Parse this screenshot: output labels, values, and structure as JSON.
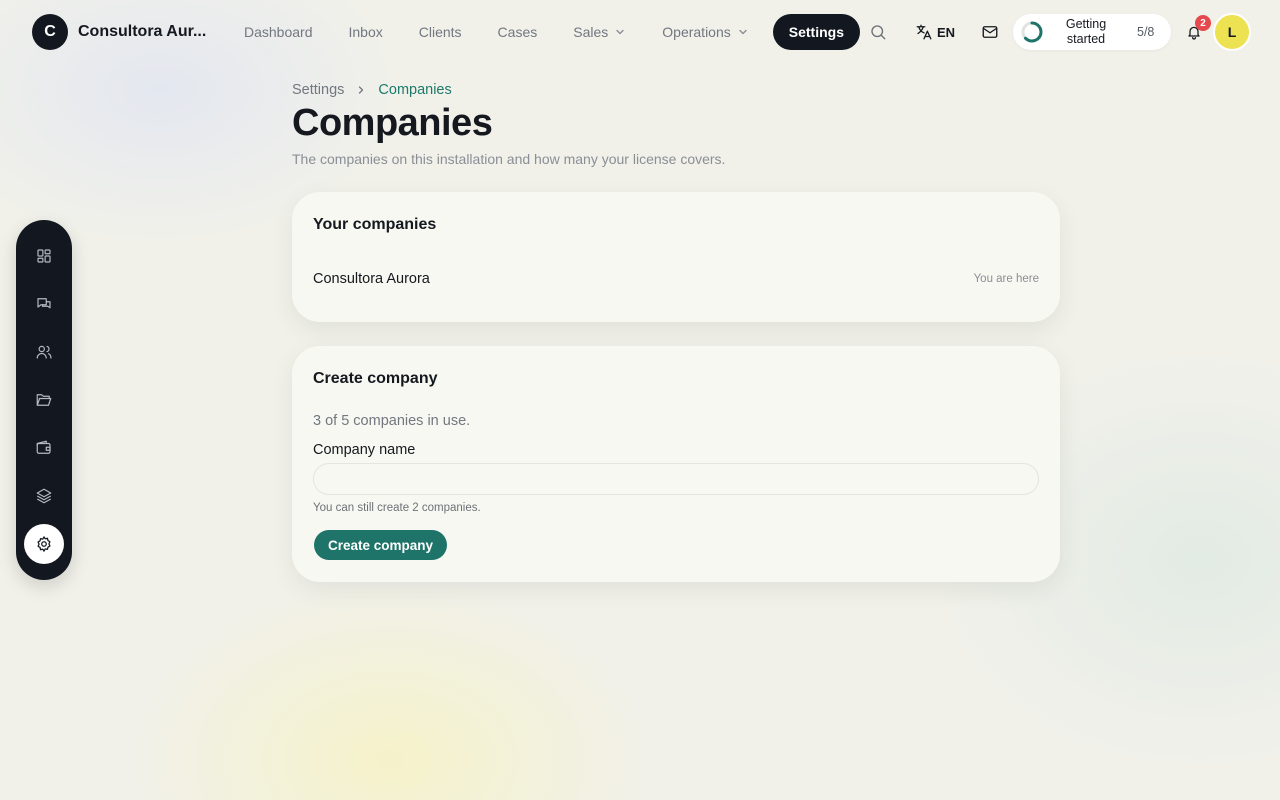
{
  "brand": {
    "logo_letter": "C",
    "name": "Consultora Aur..."
  },
  "nav": {
    "items": [
      {
        "label": "Dashboard"
      },
      {
        "label": "Inbox"
      },
      {
        "label": "Clients"
      },
      {
        "label": "Cases"
      },
      {
        "label": "Sales"
      },
      {
        "label": "Operations"
      },
      {
        "label": "Settings",
        "active": true
      }
    ]
  },
  "toolbar": {
    "search_icon": "search-icon",
    "language": "EN",
    "mail_icon": "mail-icon",
    "getting_started": {
      "label": "Getting started",
      "count": "5/8",
      "progress": 0.625
    },
    "notifications": {
      "count": "2"
    },
    "avatar_initial": "L"
  },
  "sidebar": {
    "items": [
      {
        "icon": "dashboard-icon"
      },
      {
        "icon": "chat-icon"
      },
      {
        "icon": "users-icon"
      },
      {
        "icon": "folder-icon"
      },
      {
        "icon": "wallet-icon"
      },
      {
        "icon": "layers-icon"
      },
      {
        "icon": "gear-icon",
        "active": true
      }
    ]
  },
  "breadcrumb": {
    "parent": "Settings",
    "current": "Companies"
  },
  "page": {
    "title": "Companies",
    "subtitle": "The companies on this installation and how many your license covers."
  },
  "companies_card": {
    "title": "Your companies",
    "rows": [
      {
        "name": "Consultora Aurora",
        "note": "You are here"
      }
    ]
  },
  "create_card": {
    "title": "Create company",
    "usage": "3 of 5 companies in use.",
    "field_label": "Company name",
    "field_value": "",
    "field_placeholder": "",
    "hint": "You can still create 2 companies.",
    "button_label": "Create company"
  },
  "colors": {
    "accent": "#1e7468",
    "breadcrumb_active": "#1c7a6a",
    "dark": "#131820",
    "badge": "#e5484d",
    "avatar": "#ede251"
  }
}
